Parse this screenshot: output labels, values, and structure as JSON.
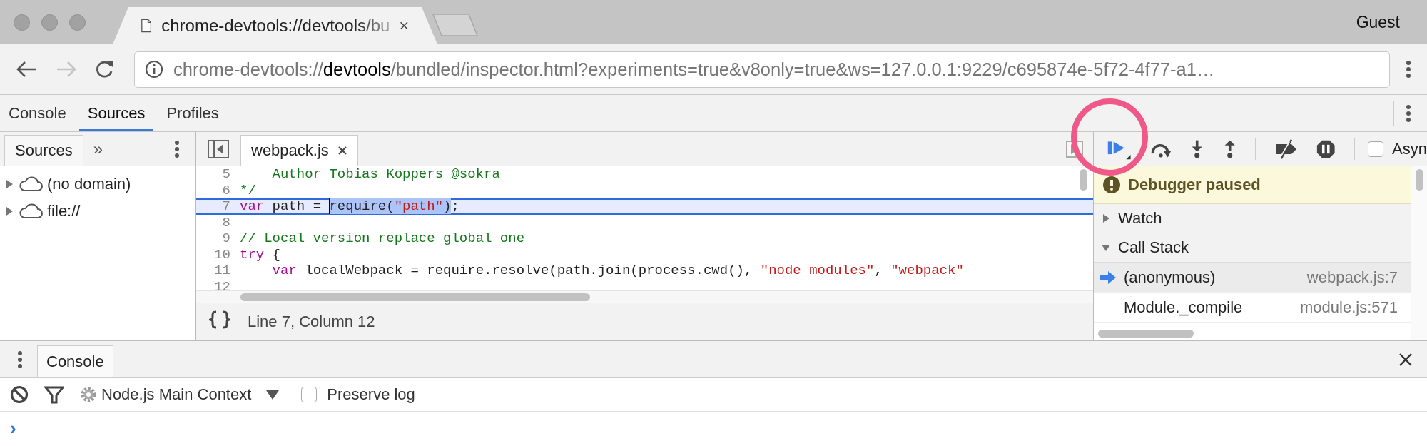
{
  "browser": {
    "tab": {
      "title": "chrome-devtools://devtools/bu",
      "selected": true
    },
    "profile": "Guest",
    "address": "chrome-devtools://**devtools**/bundled/inspector.html?experiments=true&v8only=true&ws=127.0.0.1:9229/c695874e-5f72-4f77-a1…"
  },
  "devtools": {
    "tabs": [
      {
        "label": "Console",
        "selected": false
      },
      {
        "label": "Sources",
        "selected": true
      },
      {
        "label": "Profiles",
        "selected": false
      }
    ]
  },
  "navigator": {
    "tabs": [
      {
        "label": "Sources",
        "selected": true
      }
    ],
    "more": "»",
    "tree": [
      {
        "label": "(no domain)",
        "expanded": false
      },
      {
        "label": "file://",
        "expanded": false
      }
    ]
  },
  "editor": {
    "tabs": [
      {
        "label": "webpack.js",
        "selected": true
      }
    ],
    "lines": [
      {
        "number": "5",
        "current": false,
        "tokens": [
          {
            "kind": "comment",
            "text": "    Author Tobias Koppers @sokra",
            "selected": false
          }
        ]
      },
      {
        "number": "6",
        "current": false,
        "tokens": [
          {
            "kind": "comment",
            "text": "*/",
            "selected": false
          }
        ]
      },
      {
        "number": "7",
        "current": true,
        "tokens": [
          {
            "kind": "keyword",
            "text": "var",
            "selected": false
          },
          {
            "kind": "plain",
            "text": " path = ",
            "selected": false
          },
          {
            "kind": "plain",
            "text": "require(",
            "selected": true
          },
          {
            "kind": "string",
            "text": "\"path\"",
            "selected": true
          },
          {
            "kind": "plain",
            "text": ")",
            "selected": true
          },
          {
            "kind": "plain",
            "text": ";",
            "selected": false
          }
        ]
      },
      {
        "number": "8",
        "current": false
      },
      {
        "number": "9",
        "current": false,
        "tokens": [
          {
            "kind": "comment",
            "text": "// Local version replace global one",
            "selected": false
          }
        ]
      },
      {
        "number": "10",
        "current": false,
        "tokens": [
          {
            "kind": "keyword",
            "text": "try",
            "selected": false
          },
          {
            "kind": "plain",
            "text": " {",
            "selected": false
          }
        ]
      },
      {
        "number": "11",
        "current": false,
        "tokens": [
          {
            "kind": "keyword",
            "text": "    var",
            "selected": false
          },
          {
            "kind": "plain",
            "text": " localWebpack = require.resolve(path.join(process.cwd(), ",
            "selected": false
          },
          {
            "kind": "string",
            "text": "\"node_modules\"",
            "selected": false
          },
          {
            "kind": "plain",
            "text": ", ",
            "selected": false
          },
          {
            "kind": "string",
            "text": "\"webpack\"",
            "selected": false
          }
        ]
      },
      {
        "number": "12",
        "current": false
      }
    ],
    "status": "Line 7, Column 12"
  },
  "debugger": {
    "async": {
      "label": "Asyn",
      "checked": false
    },
    "paused_message": "Debugger paused",
    "sections": [
      {
        "label": "Watch",
        "expanded": false
      },
      {
        "label": "Call Stack",
        "expanded": true
      }
    ],
    "call_stack": [
      {
        "function": "(anonymous)",
        "location": "webpack.js:7",
        "selected": true
      },
      {
        "function": "Module._compile",
        "location": "module.js:571",
        "selected": false
      }
    ]
  },
  "drawer": {
    "tabs": [
      {
        "label": "Console",
        "selected": true
      }
    ],
    "context": "Node.js Main Context",
    "preserve_log": {
      "label": "Preserve log",
      "checked": false
    },
    "prompt": "›"
  }
}
